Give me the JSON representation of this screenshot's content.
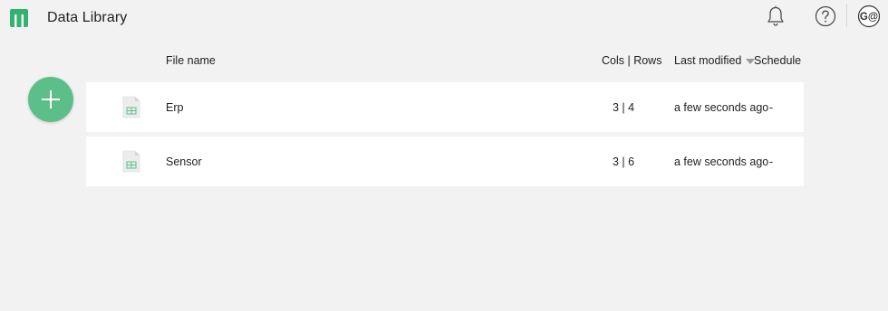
{
  "app": {
    "title": "Data Library",
    "avatar_initials": "G@"
  },
  "colors": {
    "accent_green": "#5cbf8a",
    "logo_green": "#2fb36f",
    "background": "#f2f2f2",
    "row_background": "#ffffff"
  },
  "icons": {
    "logo": "logo-icon",
    "notifications": "bell-icon",
    "help": "question-circle-icon",
    "add": "plus-icon",
    "file": "spreadsheet-file-icon",
    "sort": "sort-down-icon"
  },
  "table": {
    "headers": {
      "file_name": "File name",
      "cols_rows": "Cols | Rows",
      "last_modified": "Last modified",
      "schedule": "Schedule"
    },
    "sort": {
      "column": "Last modified",
      "direction": "descending"
    },
    "rows": [
      {
        "name": "Erp",
        "cols_rows": "3 | 4",
        "last_modified": "a few seconds ago",
        "schedule": "-"
      },
      {
        "name": "Sensor",
        "cols_rows": "3 | 6",
        "last_modified": "a few seconds ago",
        "schedule": "-"
      }
    ]
  }
}
